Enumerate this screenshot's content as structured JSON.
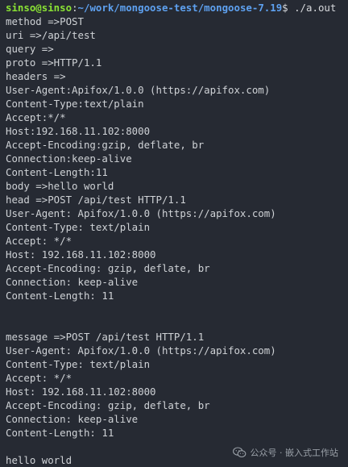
{
  "prompt": {
    "user_host": "sinso@sinso",
    "path": "~/work/mongoose-test/mongoose-7.19",
    "sign": "$",
    "command": " ./a.out"
  },
  "output_lines": [
    "method =>POST",
    "uri =>/api/test",
    "query =>",
    "proto =>HTTP/1.1",
    "headers =>",
    "User-Agent:Apifox/1.0.0 (https://apifox.com)",
    "Content-Type:text/plain",
    "Accept:*/*",
    "Host:192.168.11.102:8000",
    "Accept-Encoding:gzip, deflate, br",
    "Connection:keep-alive",
    "Content-Length:11",
    "body =>hello world",
    "head =>POST /api/test HTTP/1.1",
    "User-Agent: Apifox/1.0.0 (https://apifox.com)",
    "Content-Type: text/plain",
    "Accept: */*",
    "Host: 192.168.11.102:8000",
    "Accept-Encoding: gzip, deflate, br",
    "Connection: keep-alive",
    "Content-Length: 11",
    "",
    "",
    "message =>POST /api/test HTTP/1.1",
    "User-Agent: Apifox/1.0.0 (https://apifox.com)",
    "Content-Type: text/plain",
    "Accept: */*",
    "Host: 192.168.11.102:8000",
    "Accept-Encoding: gzip, deflate, br",
    "Connection: keep-alive",
    "Content-Length: 11",
    "",
    "hello world"
  ],
  "watermark": {
    "text": "公众号 · 嵌入式工作站",
    "icon": "wechat-icon"
  },
  "colors": {
    "background": "#262a33",
    "text": "#cfd2d6",
    "prompt_user": "#8ae234",
    "prompt_path": "#5ea1f0"
  }
}
